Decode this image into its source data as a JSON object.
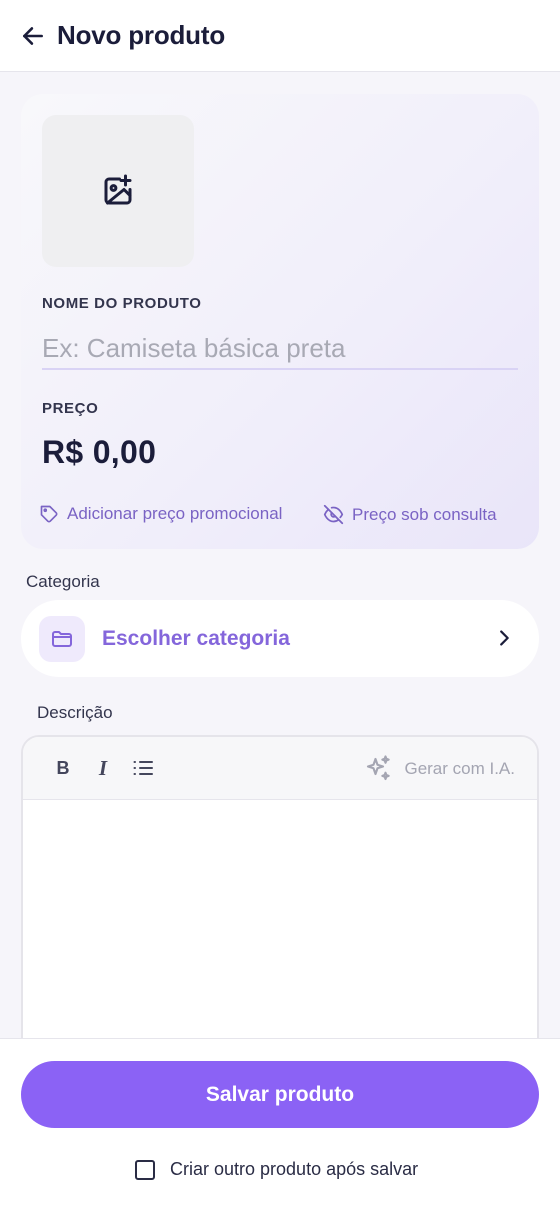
{
  "header": {
    "title": "Novo produto",
    "back_icon": "arrow-left-icon"
  },
  "card": {
    "photo_icon": "image-plus-icon",
    "name_label": "NOME DO PRODUTO",
    "name_placeholder": "Ex: Camiseta básica preta",
    "name_value": "",
    "price_label": "PREÇO",
    "price_value": "R$ 0,00",
    "promo_link": "Adicionar preço promocional",
    "consult_link": "Preço sob consulta"
  },
  "category": {
    "section_label": "Categoria",
    "button_label": "Escolher categoria",
    "icon": "folder-icon"
  },
  "description": {
    "section_label": "Descrição",
    "toolbar": {
      "bold": "B",
      "italic": "I",
      "list_icon": "list-icon",
      "ai_label": "Gerar com I.A.",
      "ai_icon": "sparkles-icon"
    },
    "value": ""
  },
  "footer": {
    "save_label": "Salvar produto",
    "create_another_label": "Criar outro produto após salvar",
    "create_another_checked": false
  },
  "colors": {
    "accent": "#8b62f5",
    "accent_text": "#8466db",
    "link": "#7a63c4",
    "text": "#1b1d3a",
    "background": "#f6f5fa"
  }
}
